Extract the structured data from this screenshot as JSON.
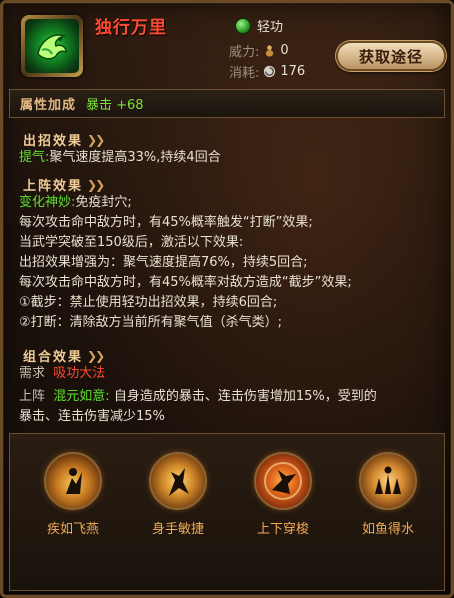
{
  "header": {
    "title": "独行万里",
    "type_label": "轻功",
    "power_key": "威力:",
    "power_value": "0",
    "cost_key": "消耗:",
    "cost_value": "176",
    "obtain_button": "获取途径"
  },
  "attribute": {
    "title": "属性加成",
    "value": "暴击 +68"
  },
  "cast_effect": {
    "title": "出招效果",
    "line1_label": "提气:",
    "line1_text": "聚气速度提高33%,持续4回合"
  },
  "deploy_effect": {
    "title": "上阵效果",
    "subtitle_label": "变化神妙:",
    "subtitle_text": "免疫封穴;",
    "lines": [
      "每次攻击命中敌方时，有45%概率触发“打断”效果;",
      "当武学突破至150级后，激活以下效果:",
      "出招效果增强为：聚气速度提高76%，持续5回合;",
      "每次攻击命中敌方时，有45%概率对敌方造成“截步”效果;",
      "①截步：禁止使用轻功出招效果，持续6回合;",
      "②打断：清除敌方当前所有聚气值（杀气类）;"
    ]
  },
  "combo_effect": {
    "title": "组合效果",
    "req_key": "需求",
    "req_value": "吸功大法",
    "deploy_key": "上阵",
    "deploy_name": "混元如意:",
    "deploy_text1": "自身造成的暴击、连击伤害增加15%，受到的",
    "deploy_text2": "暴击、连击伤害减少15%"
  },
  "skills": [
    {
      "name": "疾如飞燕",
      "icon": "flying-swallow-icon"
    },
    {
      "name": "身手敏捷",
      "icon": "agile-warrior-icon"
    },
    {
      "name": "上下穿梭",
      "icon": "shuttle-kick-icon"
    },
    {
      "name": "如鱼得水",
      "icon": "fish-in-water-icon"
    }
  ],
  "colors": {
    "title_red": "#ff4a32",
    "effect_green": "#5fe02f",
    "section_gold": "#f0cc98",
    "skill_orange": "#f1ab54"
  }
}
